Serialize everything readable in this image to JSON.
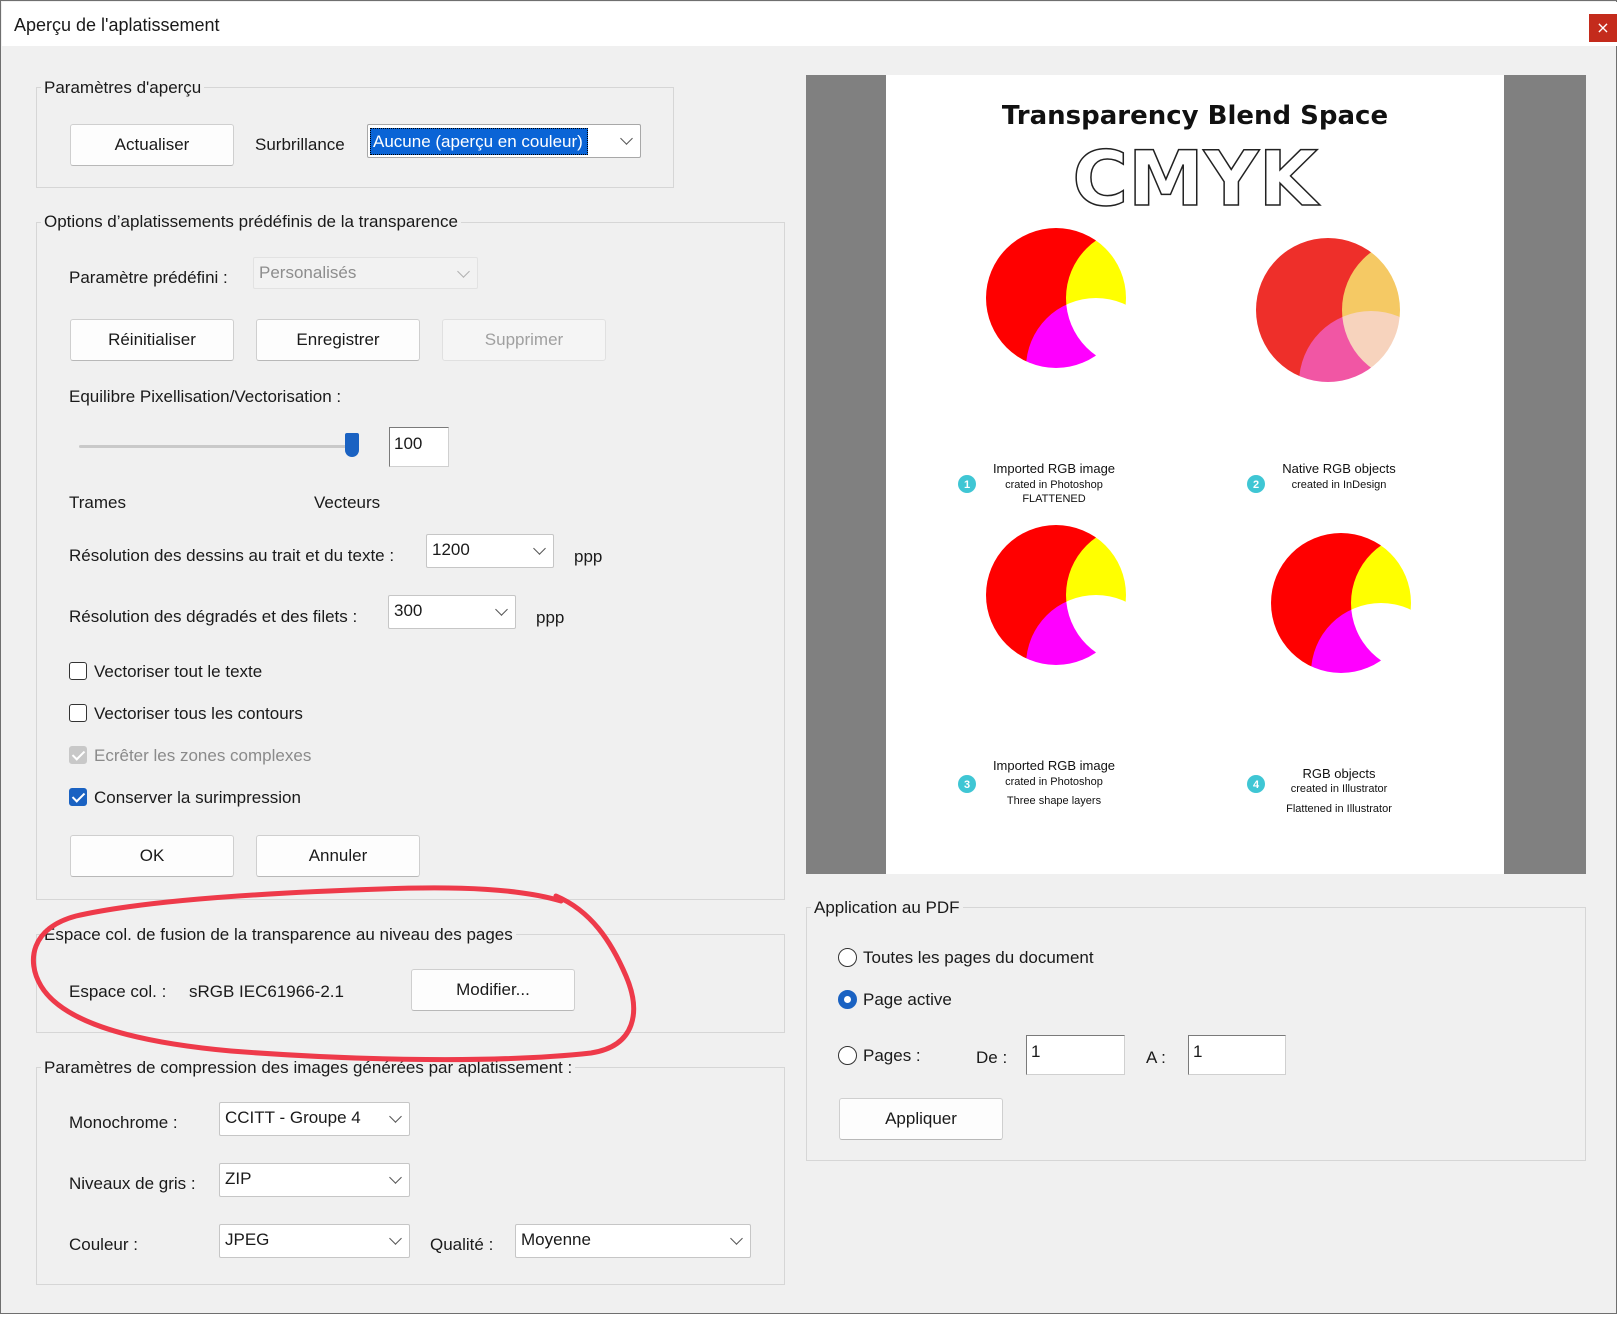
{
  "window": {
    "title": "Aperçu de l'aplatissement",
    "close_glyph": "×"
  },
  "preview_params": {
    "legend": "Paramètres d'aperçu",
    "refresh_label": "Actualiser",
    "highlight_label": "Surbrillance",
    "highlight_value": "Aucune (aperçu en couleur)"
  },
  "presets": {
    "legend": "Options d’aplatissements prédéfinis de la transparence",
    "preset_label": "Paramètre prédéfini :",
    "preset_value": "Personalisés",
    "reset_label": "Réinitialiser",
    "save_label": "Enregistrer",
    "delete_label": "Supprimer",
    "balance_label": "Equilibre Pixellisation/Vectorisation :",
    "balance_value": "100",
    "balance_fraction": 1.0,
    "raster_label": "Trames",
    "vector_label": "Vecteurs",
    "line_res_label": "Résolution des dessins au trait et du texte :",
    "line_res_value": "1200",
    "gradient_res_label": "Résolution des dégradés et des filets :",
    "gradient_res_value": "300",
    "unit": "ppp",
    "opt_text": {
      "label": "Vectoriser tout le texte",
      "checked": false
    },
    "opt_strokes": {
      "label": "Vectoriser tous les contours",
      "checked": false
    },
    "opt_clip": {
      "label": "Ecrêter les zones complexes",
      "checked": true,
      "disabled": true
    },
    "opt_overprint": {
      "label": "Conserver la surimpression",
      "checked": true
    },
    "ok_label": "OK",
    "cancel_label": "Annuler"
  },
  "blend_space": {
    "legend": "Espace col. de fusion de la transparence au niveau des pages",
    "space_label": "Espace col. :",
    "space_value": "sRGB IEC61966-2.1",
    "modify_label": "Modifier...",
    "annotation_color": "#ee3a4a"
  },
  "compression": {
    "legend": "Paramètres de compression des images générées par aplatissement :",
    "mono_label": "Monochrome :",
    "mono_value": "CCITT - Groupe 4",
    "gray_label": "Niveaux de gris :",
    "gray_value": "ZIP",
    "color_label": "Couleur :",
    "color_value": "JPEG",
    "quality_label": "Qualité :",
    "quality_value": "Moyenne"
  },
  "preview": {
    "title": "Transparency Blend Space",
    "subtitle": "CMYK",
    "panels": [
      {
        "number": "1",
        "line1": "Imported RGB image",
        "line2": "crated in Photoshop",
        "line3": "FLATTENED"
      },
      {
        "number": "2",
        "line1": "Native RGB objects",
        "line2": "created in InDesign",
        "line3": ""
      },
      {
        "number": "3",
        "line1": "Imported RGB image",
        "line2": "crated in Photoshop",
        "line3": "Three shape layers"
      },
      {
        "number": "4",
        "line1": "RGB objects",
        "line2": "created in Illustrator",
        "line3": "Flattened in Illustrator"
      }
    ]
  },
  "apply_pdf": {
    "legend": "Application au PDF",
    "all_pages_label": "Toutes les pages du document",
    "active_page_label": "Page active",
    "pages_label": "Pages :",
    "from_label": "De :",
    "from_value": "1",
    "to_label": "A :",
    "to_value": "1",
    "selected": "active_page",
    "apply_label": "Appliquer"
  },
  "colors": {
    "accent": "#1a62c2",
    "close": "#c42b1c",
    "highlight_bg": "#0a64d6"
  }
}
